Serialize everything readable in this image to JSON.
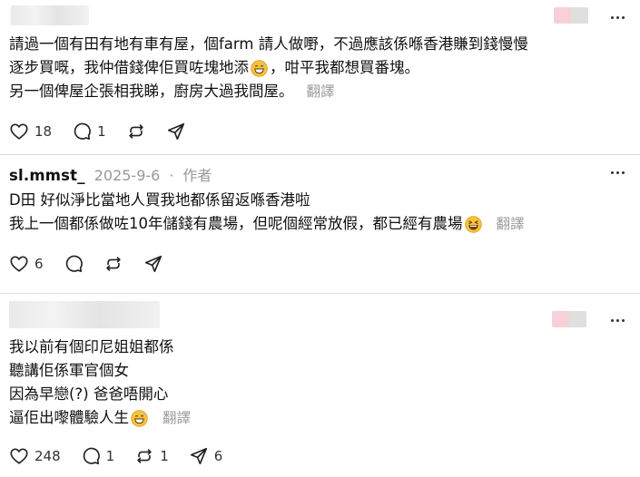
{
  "posts": [
    {
      "lines": [
        "請過一個有田有地有車有屋，個farm 請人做嘢￼，不過應該係喺香港賺到錢慢慢",
        "逐步買嘅，我仲借錢俾佢買咗塊地添",
        "，咁平我都想買番塊。",
        "另一個俾屋企張相我睇，廚房大過我間屋。"
      ],
      "translate": "翻譯",
      "likes": "18",
      "comments": "1"
    },
    {
      "username": "sl.mmst_",
      "date": "2025-9-6",
      "separator": "·",
      "author_tag": "作者",
      "lines": [
        "D田 好似淨比當地人買￼我地都係留返喺香港啦",
        "我上一個都係做咗10年儲錢有農場，但呢個經常放假，都已經有農場"
      ],
      "translate": "翻譯",
      "likes": "6"
    },
    {
      "lines": [
        "我以前有個印尼姐姐都係",
        "聽講佢係軍官個女",
        "因為早戀(?) 爸爸唔開心",
        "逼佢出嚟體驗人生"
      ],
      "translate": "翻譯",
      "likes": "248",
      "comments": "1",
      "reposts": "1",
      "shares": "6"
    }
  ],
  "icons": {
    "like": "heart-icon",
    "comment": "comment-icon",
    "repost": "repost-icon",
    "share": "share-icon",
    "more": "more-icon",
    "emoji_grin": "grinning-sweat-emoji",
    "emoji_laugh": "laughing-emoji"
  },
  "colors": {
    "text": "#101010",
    "muted": "#999999",
    "divider": "#dcdcdc",
    "emoji": "#f5c33b"
  }
}
